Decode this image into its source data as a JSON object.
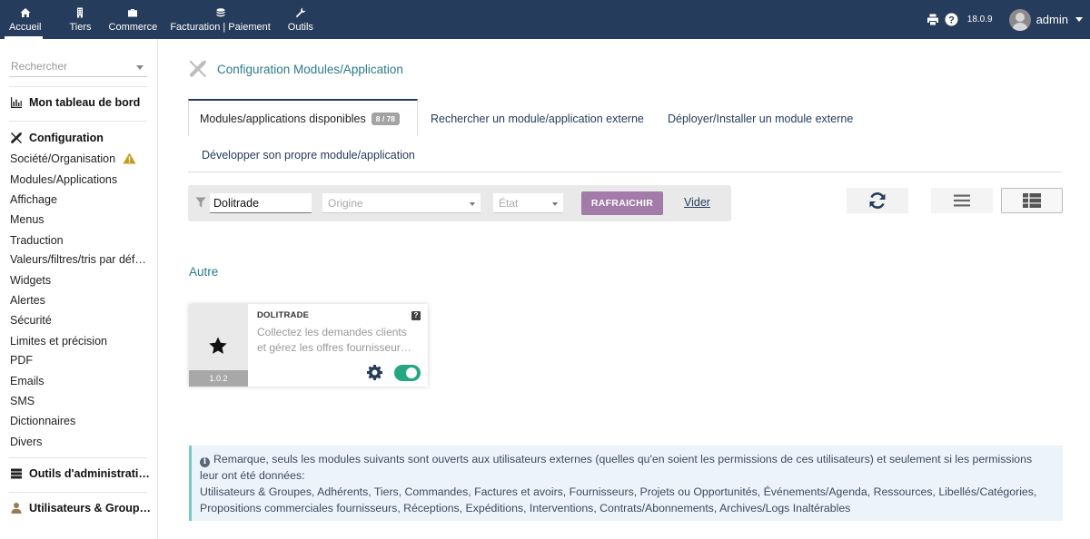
{
  "topnav": [
    {
      "label": "Accueil",
      "icon": "home-icon"
    },
    {
      "label": "Tiers",
      "icon": "building-icon"
    },
    {
      "label": "Commerce",
      "icon": "briefcase-icon"
    },
    {
      "label": "Facturation | Paiement",
      "icon": "money-icon"
    },
    {
      "label": "Outils",
      "icon": "wrench-icon"
    }
  ],
  "topright": {
    "version": "18.0.9",
    "username": "admin"
  },
  "sidebar": {
    "search_placeholder": "Rechercher",
    "dashboard": "Mon tableau de bord",
    "config_title": "Configuration",
    "config_items": [
      "Société/Organisation",
      "Modules/Applications",
      "Affichage",
      "Menus",
      "Traduction",
      "Valeurs/filtres/tris par déf…",
      "Widgets",
      "Alertes",
      "Sécurité",
      "Limites et précision",
      "PDF",
      "Emails",
      "SMS",
      "Dictionnaires",
      "Divers"
    ],
    "admin_tools": "Outils d'administrati…",
    "users_groups": "Utilisateurs & Group…"
  },
  "main": {
    "title": "Configuration Modules/Application",
    "tabs": [
      {
        "label": "Modules/applications disponibles",
        "badge": "8 / 78"
      },
      {
        "label": "Rechercher un module/application externe"
      },
      {
        "label": "Déployer/Installer un module externe"
      },
      {
        "label": "Développer son propre module/application"
      }
    ],
    "filter": {
      "search_value": "Dolitrade",
      "origin_placeholder": "Origine",
      "state_placeholder": "État",
      "refresh_label": "RAFRAICHIR",
      "clear_label": "Vider"
    },
    "section_title": "Autre",
    "module": {
      "name": "DOLITRADE",
      "help": "?",
      "desc_line1": "Collectez les demandes clients",
      "desc_line2": "et gérez les offres fournisseur…",
      "version": "1.0.2",
      "enabled": true
    },
    "note": {
      "line1": "Remarque, seuls les modules suivants sont ouverts aux utilisateurs externes (quelles qu'en soient les permissions de ces utilisateurs) et seulement si les permissions leur ont été données:",
      "line2": "Utilisateurs & Groupes, Adhérents, Tiers, Commandes, Factures et avoirs, Fournisseurs, Projets ou Opportunités, Événements/Agenda, Ressources, Libellés/Catégories, Propositions commerciales fournisseurs, Réceptions, Expéditions, Interventions, Contrats/Abonnements, Archives/Logs Inaltérables"
    }
  },
  "colors": {
    "topbar": "#263c5c",
    "link": "#2c7b8d",
    "refresh": "#a27ba8",
    "toggle_on": "#23a883",
    "note_border": "#76c9c4"
  }
}
